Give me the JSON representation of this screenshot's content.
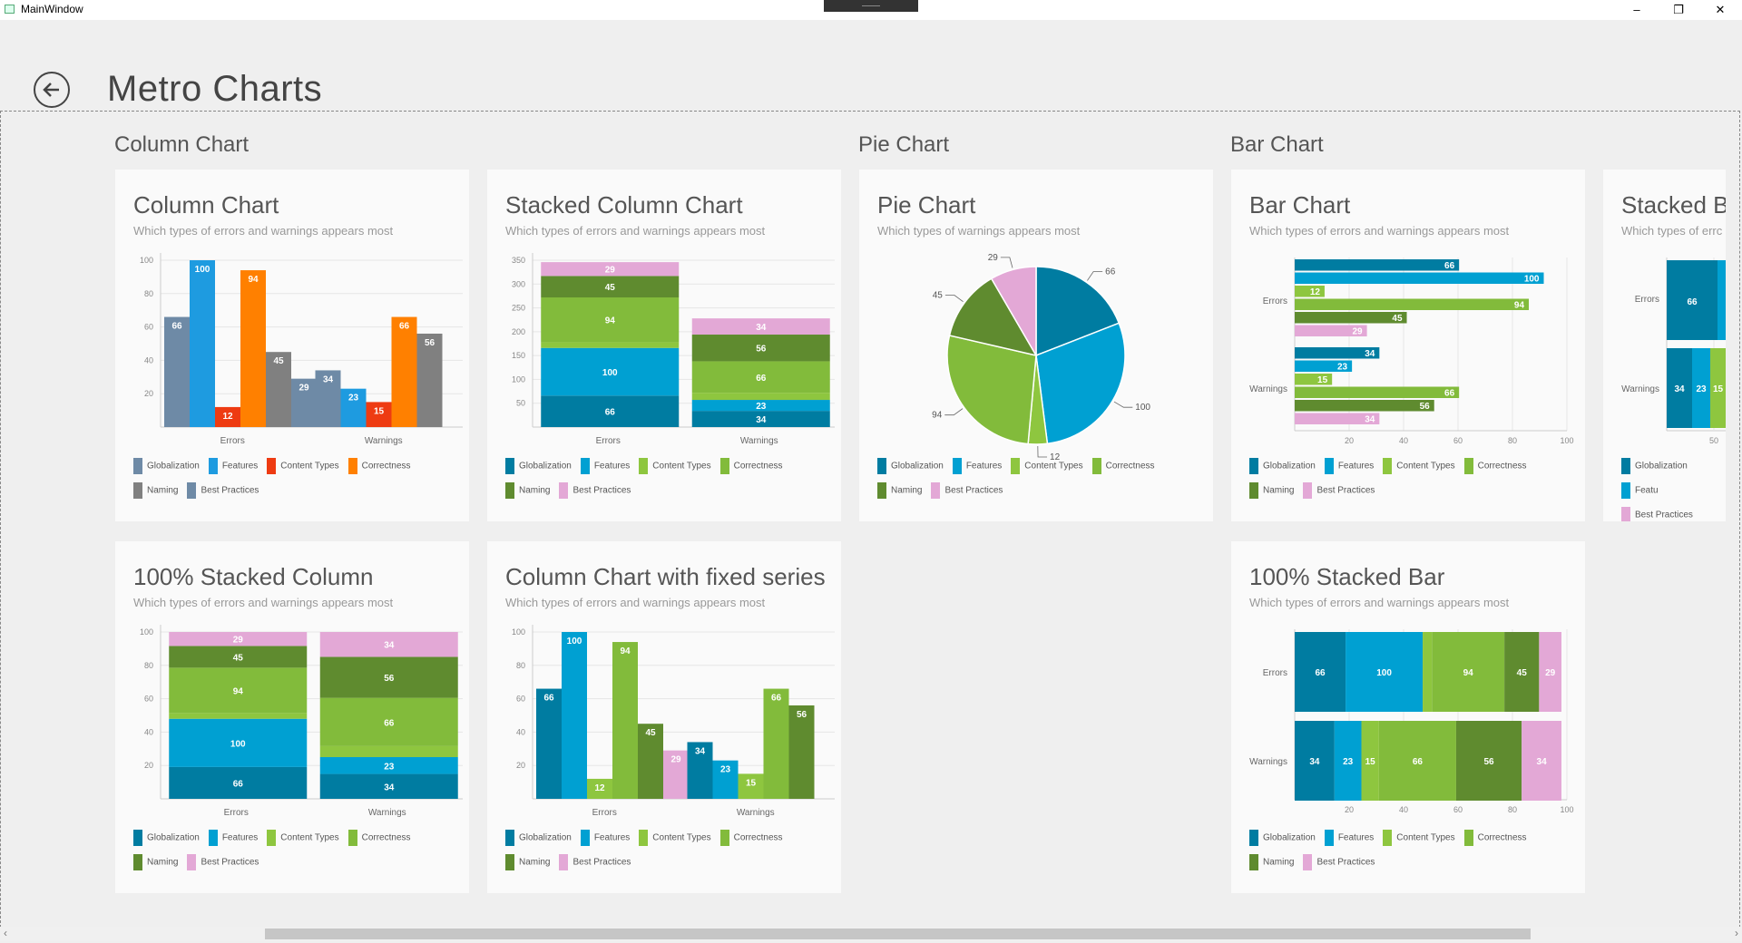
{
  "window": {
    "title": "MainWindow",
    "minimize": "–",
    "restore": "❐",
    "close": "✕"
  },
  "page": {
    "title": "Metro Charts",
    "back_icon": "arrow-left-circle-icon"
  },
  "sections": {
    "column": "Column Chart",
    "pie": "Pie Chart",
    "bar": "Bar Chart"
  },
  "colors": {
    "Globalization": "#007ca1",
    "Features": "#00a0d2",
    "Content Types": "#8ec63f",
    "Correctness": "#82bb3b",
    "Naming": "#5f8b2f",
    "Best Practices": "#e3a8d6"
  },
  "legend": [
    "Globalization",
    "Features",
    "Content Types",
    "Correctness",
    "Naming",
    "Best Practices"
  ],
  "cards": {
    "column": {
      "title": "Column Chart",
      "subtitle": "Which types of errors and warnings appears most",
      "legend_colors": [
        "#6e8aa6",
        "#1e9be0",
        "#ee3b12",
        "#ff8000",
        "#808080",
        "#6e8aa6"
      ]
    },
    "stacked_column": {
      "title": "Stacked Column Chart",
      "subtitle": "Which types of errors and warnings appears most"
    },
    "pie": {
      "title": "Pie Chart",
      "subtitle": "Which types of warnings appears most"
    },
    "bar": {
      "title": "Bar Chart",
      "subtitle": "Which types of errors and warnings appears most"
    },
    "stacked_bar": {
      "title": "Stacked Ba",
      "subtitle": "Which types of errc",
      "legend": [
        "Globalization",
        "Featu",
        "Best Practices"
      ]
    },
    "pct_column": {
      "title": "100% Stacked Column",
      "subtitle": "Which types of errors and warnings appears most"
    },
    "fixed": {
      "title": "Column Chart with fixed series",
      "subtitle": "Which types of errors and warnings appears most"
    },
    "pct_bar": {
      "title": "100% Stacked Bar",
      "subtitle": "Which types of errors and warnings appears most"
    }
  },
  "chart_data": [
    {
      "id": "column",
      "type": "bar",
      "categories": [
        "Errors",
        "Warnings"
      ],
      "series": [
        {
          "name": "Globalization",
          "values": [
            66,
            34
          ]
        },
        {
          "name": "Features",
          "values": [
            100,
            23
          ]
        },
        {
          "name": "Content Types",
          "values": [
            12,
            15
          ]
        },
        {
          "name": "Correctness",
          "values": [
            94,
            66
          ]
        },
        {
          "name": "Naming",
          "values": [
            45,
            56
          ]
        },
        {
          "name": "Best Practices",
          "values": [
            29,
            null
          ]
        }
      ],
      "yticks": [
        "20",
        "40",
        "60",
        "80",
        "100"
      ],
      "ylim": [
        0,
        100
      ]
    },
    {
      "id": "stacked_column",
      "type": "bar",
      "stacked": true,
      "categories": [
        "Errors",
        "Warnings"
      ],
      "series": [
        {
          "name": "Globalization",
          "values": [
            66,
            34
          ]
        },
        {
          "name": "Features",
          "values": [
            100,
            23
          ]
        },
        {
          "name": "Content Types",
          "values": [
            12,
            15
          ]
        },
        {
          "name": "Correctness",
          "values": [
            94,
            66
          ]
        },
        {
          "name": "Naming",
          "values": [
            45,
            56
          ]
        },
        {
          "name": "Best Practices",
          "values": [
            29,
            34
          ]
        }
      ],
      "yticks": [
        "50",
        "100",
        "150",
        "200",
        "250",
        "300",
        "350"
      ],
      "ylim": [
        0,
        350
      ]
    },
    {
      "id": "pie",
      "type": "pie",
      "labels": [
        "Globalization",
        "Features",
        "Content Types",
        "Correctness",
        "Naming",
        "Best Practices"
      ],
      "values": [
        66,
        100,
        12,
        94,
        45,
        29
      ]
    },
    {
      "id": "bar",
      "type": "bar",
      "orientation": "horizontal",
      "categories": [
        "Errors",
        "Warnings"
      ],
      "series": [
        {
          "name": "Globalization",
          "values": [
            66,
            34
          ]
        },
        {
          "name": "Features",
          "values": [
            100,
            23
          ]
        },
        {
          "name": "Content Types",
          "values": [
            12,
            15
          ]
        },
        {
          "name": "Correctness",
          "values": [
            94,
            66
          ]
        },
        {
          "name": "Naming",
          "values": [
            45,
            56
          ]
        },
        {
          "name": "Best Practices",
          "values": [
            29,
            34
          ]
        }
      ],
      "xticks": [
        "20",
        "40",
        "60",
        "80",
        "100"
      ],
      "xlim": [
        0,
        100
      ]
    },
    {
      "id": "stacked_bar",
      "type": "bar",
      "orientation": "horizontal",
      "stacked": true,
      "categories": [
        "Errors",
        "Warnings"
      ],
      "visible_values": {
        "Errors": [
          66
        ],
        "Warnings": [
          34,
          23,
          15
        ]
      },
      "xticks": [
        "50"
      ]
    },
    {
      "id": "pct_column",
      "type": "bar",
      "stacked": "percent",
      "categories": [
        "Errors",
        "Warnings"
      ],
      "series": [
        {
          "name": "Globalization",
          "values": [
            66,
            34
          ]
        },
        {
          "name": "Features",
          "values": [
            100,
            23
          ]
        },
        {
          "name": "Content Types",
          "values": [
            12,
            15
          ]
        },
        {
          "name": "Correctness",
          "values": [
            94,
            66
          ]
        },
        {
          "name": "Naming",
          "values": [
            45,
            56
          ]
        },
        {
          "name": "Best Practices",
          "values": [
            29,
            34
          ]
        }
      ],
      "yticks": [
        "20",
        "40",
        "60",
        "80",
        "100"
      ],
      "ylim": [
        0,
        100
      ]
    },
    {
      "id": "fixed",
      "type": "bar",
      "categories": [
        "Errors",
        "Warnings"
      ],
      "series": [
        {
          "name": "Globalization",
          "values": [
            66,
            34
          ]
        },
        {
          "name": "Features",
          "values": [
            100,
            23
          ]
        },
        {
          "name": "Content Types",
          "values": [
            12,
            15
          ]
        },
        {
          "name": "Correctness",
          "values": [
            94,
            66
          ]
        },
        {
          "name": "Naming",
          "values": [
            45,
            56
          ]
        },
        {
          "name": "Best Practices",
          "values": [
            29,
            null
          ]
        }
      ],
      "yticks": [
        "20",
        "40",
        "60",
        "80",
        "100"
      ],
      "ylim": [
        0,
        100
      ]
    },
    {
      "id": "pct_bar",
      "type": "bar",
      "orientation": "horizontal",
      "stacked": "percent",
      "categories": [
        "Errors",
        "Warnings"
      ],
      "series": [
        {
          "name": "Globalization",
          "values": [
            66,
            34
          ]
        },
        {
          "name": "Features",
          "values": [
            100,
            23
          ]
        },
        {
          "name": "Content Types",
          "values": [
            12,
            15
          ]
        },
        {
          "name": "Correctness",
          "values": [
            94,
            66
          ]
        },
        {
          "name": "Naming",
          "values": [
            45,
            56
          ]
        },
        {
          "name": "Best Practices",
          "values": [
            29,
            34
          ]
        }
      ],
      "xticks": [
        "20",
        "40",
        "60",
        "80",
        "100"
      ],
      "xlim": [
        0,
        100
      ]
    }
  ]
}
